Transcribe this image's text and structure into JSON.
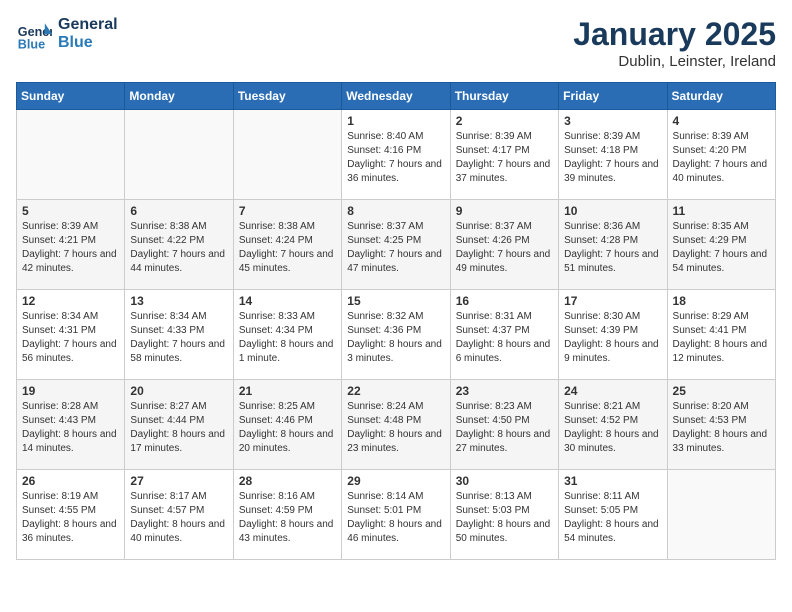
{
  "logo": {
    "line1": "General",
    "line2": "Blue"
  },
  "title": "January 2025",
  "subtitle": "Dublin, Leinster, Ireland",
  "days_header": [
    "Sunday",
    "Monday",
    "Tuesday",
    "Wednesday",
    "Thursday",
    "Friday",
    "Saturday"
  ],
  "weeks": [
    [
      {
        "day": "",
        "sunrise": "",
        "sunset": "",
        "daylight": ""
      },
      {
        "day": "",
        "sunrise": "",
        "sunset": "",
        "daylight": ""
      },
      {
        "day": "",
        "sunrise": "",
        "sunset": "",
        "daylight": ""
      },
      {
        "day": "1",
        "sunrise": "Sunrise: 8:40 AM",
        "sunset": "Sunset: 4:16 PM",
        "daylight": "Daylight: 7 hours and 36 minutes."
      },
      {
        "day": "2",
        "sunrise": "Sunrise: 8:39 AM",
        "sunset": "Sunset: 4:17 PM",
        "daylight": "Daylight: 7 hours and 37 minutes."
      },
      {
        "day": "3",
        "sunrise": "Sunrise: 8:39 AM",
        "sunset": "Sunset: 4:18 PM",
        "daylight": "Daylight: 7 hours and 39 minutes."
      },
      {
        "day": "4",
        "sunrise": "Sunrise: 8:39 AM",
        "sunset": "Sunset: 4:20 PM",
        "daylight": "Daylight: 7 hours and 40 minutes."
      }
    ],
    [
      {
        "day": "5",
        "sunrise": "Sunrise: 8:39 AM",
        "sunset": "Sunset: 4:21 PM",
        "daylight": "Daylight: 7 hours and 42 minutes."
      },
      {
        "day": "6",
        "sunrise": "Sunrise: 8:38 AM",
        "sunset": "Sunset: 4:22 PM",
        "daylight": "Daylight: 7 hours and 44 minutes."
      },
      {
        "day": "7",
        "sunrise": "Sunrise: 8:38 AM",
        "sunset": "Sunset: 4:24 PM",
        "daylight": "Daylight: 7 hours and 45 minutes."
      },
      {
        "day": "8",
        "sunrise": "Sunrise: 8:37 AM",
        "sunset": "Sunset: 4:25 PM",
        "daylight": "Daylight: 7 hours and 47 minutes."
      },
      {
        "day": "9",
        "sunrise": "Sunrise: 8:37 AM",
        "sunset": "Sunset: 4:26 PM",
        "daylight": "Daylight: 7 hours and 49 minutes."
      },
      {
        "day": "10",
        "sunrise": "Sunrise: 8:36 AM",
        "sunset": "Sunset: 4:28 PM",
        "daylight": "Daylight: 7 hours and 51 minutes."
      },
      {
        "day": "11",
        "sunrise": "Sunrise: 8:35 AM",
        "sunset": "Sunset: 4:29 PM",
        "daylight": "Daylight: 7 hours and 54 minutes."
      }
    ],
    [
      {
        "day": "12",
        "sunrise": "Sunrise: 8:34 AM",
        "sunset": "Sunset: 4:31 PM",
        "daylight": "Daylight: 7 hours and 56 minutes."
      },
      {
        "day": "13",
        "sunrise": "Sunrise: 8:34 AM",
        "sunset": "Sunset: 4:33 PM",
        "daylight": "Daylight: 7 hours and 58 minutes."
      },
      {
        "day": "14",
        "sunrise": "Sunrise: 8:33 AM",
        "sunset": "Sunset: 4:34 PM",
        "daylight": "Daylight: 8 hours and 1 minute."
      },
      {
        "day": "15",
        "sunrise": "Sunrise: 8:32 AM",
        "sunset": "Sunset: 4:36 PM",
        "daylight": "Daylight: 8 hours and 3 minutes."
      },
      {
        "day": "16",
        "sunrise": "Sunrise: 8:31 AM",
        "sunset": "Sunset: 4:37 PM",
        "daylight": "Daylight: 8 hours and 6 minutes."
      },
      {
        "day": "17",
        "sunrise": "Sunrise: 8:30 AM",
        "sunset": "Sunset: 4:39 PM",
        "daylight": "Daylight: 8 hours and 9 minutes."
      },
      {
        "day": "18",
        "sunrise": "Sunrise: 8:29 AM",
        "sunset": "Sunset: 4:41 PM",
        "daylight": "Daylight: 8 hours and 12 minutes."
      }
    ],
    [
      {
        "day": "19",
        "sunrise": "Sunrise: 8:28 AM",
        "sunset": "Sunset: 4:43 PM",
        "daylight": "Daylight: 8 hours and 14 minutes."
      },
      {
        "day": "20",
        "sunrise": "Sunrise: 8:27 AM",
        "sunset": "Sunset: 4:44 PM",
        "daylight": "Daylight: 8 hours and 17 minutes."
      },
      {
        "day": "21",
        "sunrise": "Sunrise: 8:25 AM",
        "sunset": "Sunset: 4:46 PM",
        "daylight": "Daylight: 8 hours and 20 minutes."
      },
      {
        "day": "22",
        "sunrise": "Sunrise: 8:24 AM",
        "sunset": "Sunset: 4:48 PM",
        "daylight": "Daylight: 8 hours and 23 minutes."
      },
      {
        "day": "23",
        "sunrise": "Sunrise: 8:23 AM",
        "sunset": "Sunset: 4:50 PM",
        "daylight": "Daylight: 8 hours and 27 minutes."
      },
      {
        "day": "24",
        "sunrise": "Sunrise: 8:21 AM",
        "sunset": "Sunset: 4:52 PM",
        "daylight": "Daylight: 8 hours and 30 minutes."
      },
      {
        "day": "25",
        "sunrise": "Sunrise: 8:20 AM",
        "sunset": "Sunset: 4:53 PM",
        "daylight": "Daylight: 8 hours and 33 minutes."
      }
    ],
    [
      {
        "day": "26",
        "sunrise": "Sunrise: 8:19 AM",
        "sunset": "Sunset: 4:55 PM",
        "daylight": "Daylight: 8 hours and 36 minutes."
      },
      {
        "day": "27",
        "sunrise": "Sunrise: 8:17 AM",
        "sunset": "Sunset: 4:57 PM",
        "daylight": "Daylight: 8 hours and 40 minutes."
      },
      {
        "day": "28",
        "sunrise": "Sunrise: 8:16 AM",
        "sunset": "Sunset: 4:59 PM",
        "daylight": "Daylight: 8 hours and 43 minutes."
      },
      {
        "day": "29",
        "sunrise": "Sunrise: 8:14 AM",
        "sunset": "Sunset: 5:01 PM",
        "daylight": "Daylight: 8 hours and 46 minutes."
      },
      {
        "day": "30",
        "sunrise": "Sunrise: 8:13 AM",
        "sunset": "Sunset: 5:03 PM",
        "daylight": "Daylight: 8 hours and 50 minutes."
      },
      {
        "day": "31",
        "sunrise": "Sunrise: 8:11 AM",
        "sunset": "Sunset: 5:05 PM",
        "daylight": "Daylight: 8 hours and 54 minutes."
      },
      {
        "day": "",
        "sunrise": "",
        "sunset": "",
        "daylight": ""
      }
    ]
  ]
}
